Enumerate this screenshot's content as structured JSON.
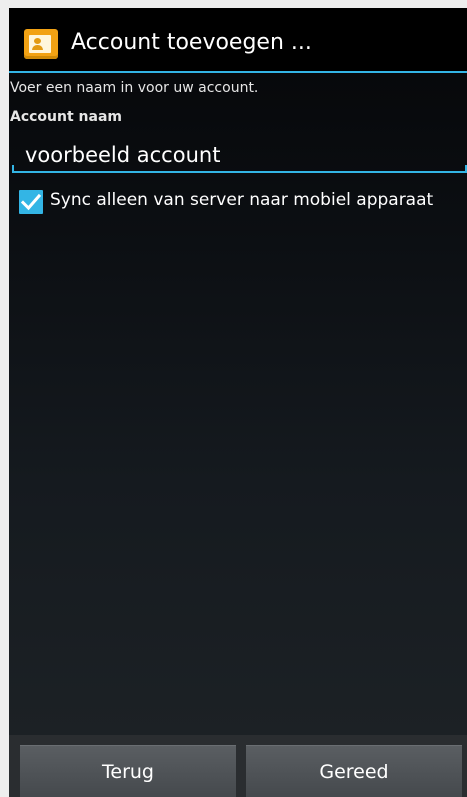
{
  "window": {
    "title": "Account toevoegen ...",
    "app_icon": "contact-card-icon"
  },
  "form": {
    "hint": "Voer een naam in voor uw account.",
    "name_label": "Account naam",
    "name_value": "voorbeeld account",
    "sync_checked": true,
    "sync_label": "Sync alleen van server naar mobiel apparaat"
  },
  "buttons": {
    "back_label": "Terug",
    "done_label": "Gereed"
  },
  "colors": {
    "accent": "#33b5e5",
    "icon": "#f2a214"
  }
}
